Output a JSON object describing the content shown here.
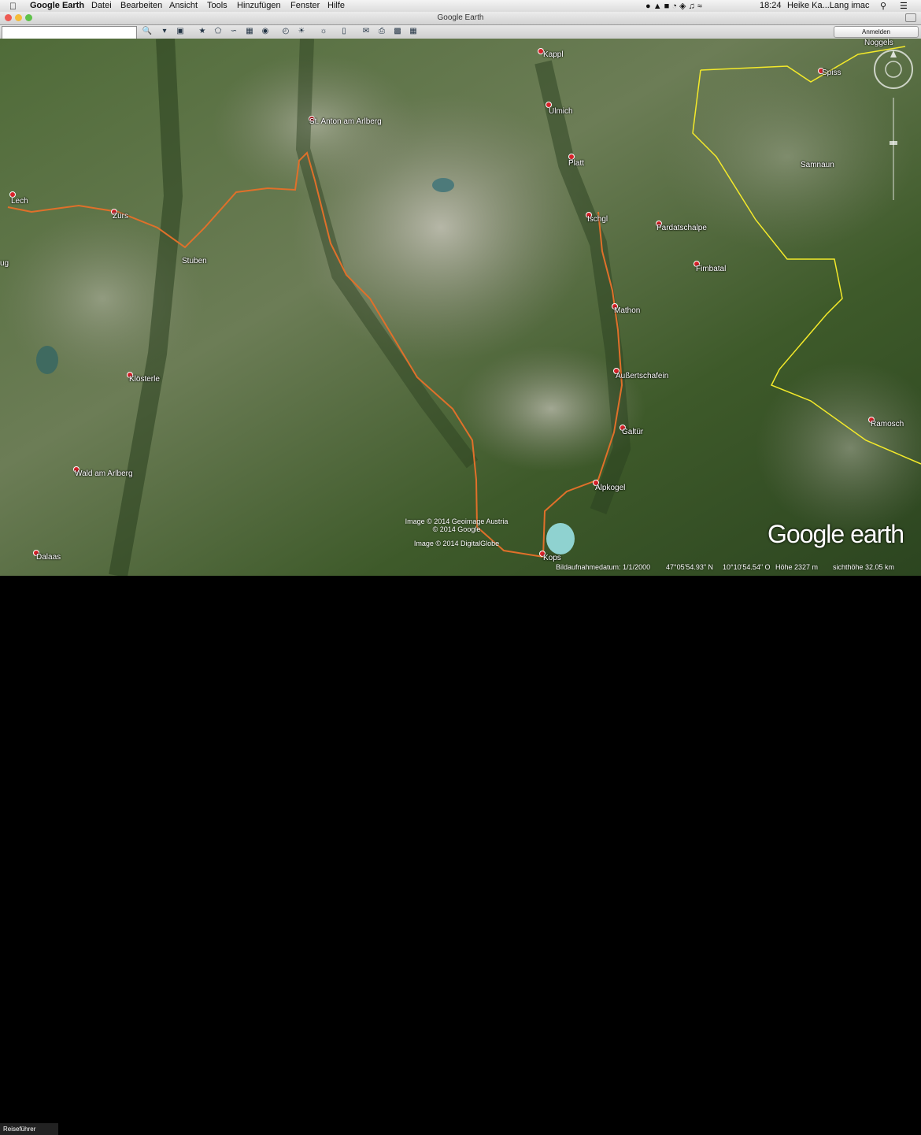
{
  "menubar": {
    "apple": "",
    "app_name": "Google Earth",
    "items": [
      "Datei",
      "Bearbeiten",
      "Ansicht",
      "Tools",
      "Hinzufügen",
      "Fenster",
      "Hilfe"
    ],
    "clock": "18:24",
    "user": "Heike Ka...Lang imac"
  },
  "window": {
    "title": "Google Earth"
  },
  "toolbar": {
    "search_value": "",
    "signin_label": "Anmelden"
  },
  "places": [
    {
      "id": "kappl",
      "name": "Kappl"
    },
    {
      "id": "ulmich",
      "name": "Ulmich"
    },
    {
      "id": "st-anton",
      "name": "St. Anton am Arlberg"
    },
    {
      "id": "platt",
      "name": "Platt"
    },
    {
      "id": "ischgl",
      "name": "Ischgl"
    },
    {
      "id": "pardatschalpe",
      "name": "Pardatschalpe"
    },
    {
      "id": "fimbatal",
      "name": "Fimbatal"
    },
    {
      "id": "mathon",
      "name": "Mathon"
    },
    {
      "id": "aussertschafein",
      "name": "Außertschafein"
    },
    {
      "id": "galtur",
      "name": "Galtür"
    },
    {
      "id": "alpkogel",
      "name": "Alpkogel"
    },
    {
      "id": "kops",
      "name": "Kops"
    },
    {
      "id": "lech",
      "name": "Lech"
    },
    {
      "id": "zurs",
      "name": "Zürs"
    },
    {
      "id": "stuben",
      "name": "Stuben"
    },
    {
      "id": "ug",
      "name": "ug"
    },
    {
      "id": "klosterle",
      "name": "Klösterle"
    },
    {
      "id": "wald",
      "name": "Wald am Arlberg"
    },
    {
      "id": "dalaas",
      "name": "Dalaas"
    },
    {
      "id": "spiss",
      "name": "Spiss"
    },
    {
      "id": "samnaun",
      "name": "Samnaun"
    },
    {
      "id": "noggels",
      "name": "Noggels"
    },
    {
      "id": "ramosch",
      "name": "Ramosch"
    }
  ],
  "copyright": [
    "Image © 2014 Geoimage Austria",
    "© 2014 Google",
    "Image © 2014 DigitalGlobe"
  ],
  "logo": "Google earth",
  "status": {
    "guide": "Reiseführer",
    "imagery_date": "Bildaufnahmedatum: 1/1/2000",
    "lat": "47°05'54.93\" N",
    "lon": "10°10'54.54\" O",
    "elevation": "Höhe 2327 m",
    "eye_alt": "sichthöhe 32.05 km"
  },
  "colors": {
    "route": "#e0702a",
    "border": "#f4ea2a",
    "pin": "#d8232a"
  }
}
